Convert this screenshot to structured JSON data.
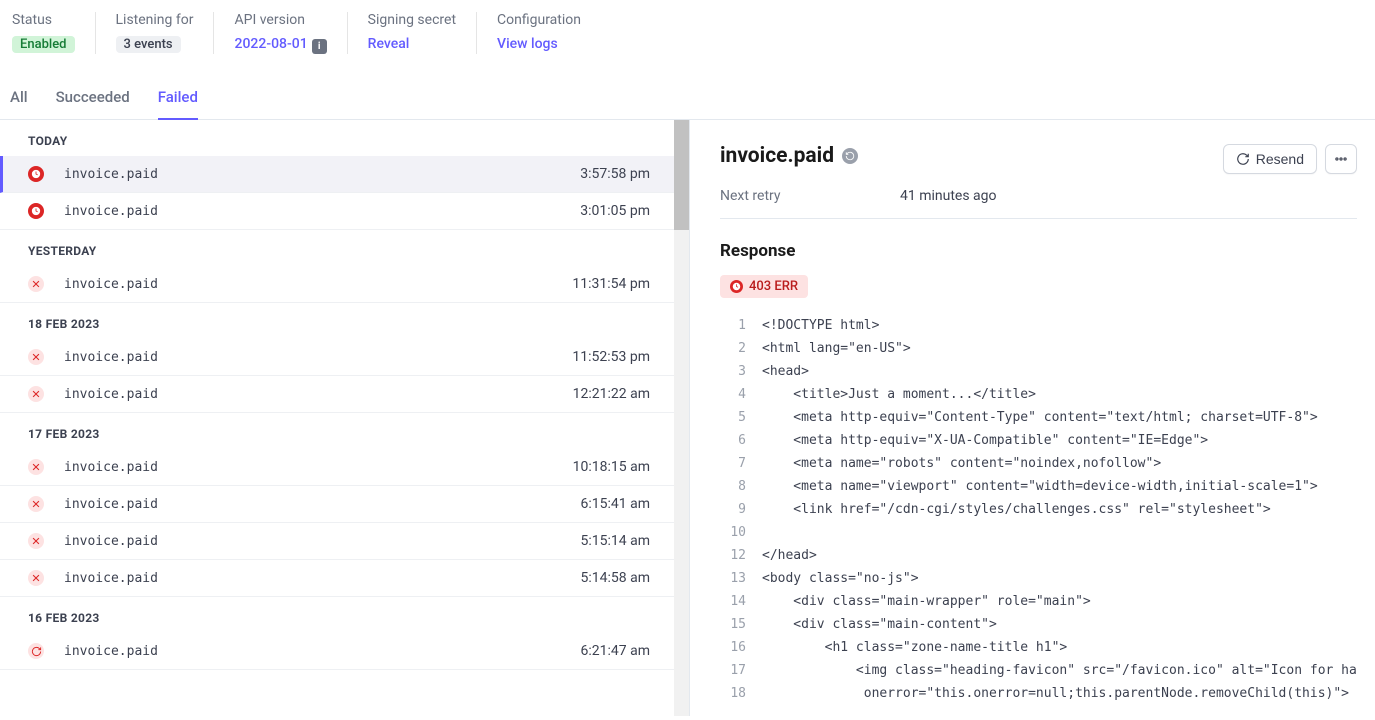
{
  "summary": {
    "status_label": "Status",
    "status_value": "Enabled",
    "listening_label": "Listening for",
    "listening_value": "3 events",
    "api_label": "API version",
    "api_value": "2022-08-01",
    "secret_label": "Signing secret",
    "secret_value": "Reveal",
    "config_label": "Configuration",
    "config_value": "View logs"
  },
  "tabs": {
    "all": "All",
    "succeeded": "Succeeded",
    "failed": "Failed"
  },
  "groups": [
    {
      "label": "TODAY",
      "events": [
        {
          "icon": "clock",
          "name": "invoice.paid",
          "time": "3:57:58 pm",
          "selected": true
        },
        {
          "icon": "clock",
          "name": "invoice.paid",
          "time": "3:01:05 pm"
        }
      ]
    },
    {
      "label": "YESTERDAY",
      "events": [
        {
          "icon": "x",
          "name": "invoice.paid",
          "time": "11:31:54 pm"
        }
      ]
    },
    {
      "label": "18 FEB 2023",
      "events": [
        {
          "icon": "x",
          "name": "invoice.paid",
          "time": "11:52:53 pm"
        },
        {
          "icon": "x",
          "name": "invoice.paid",
          "time": "12:21:22 am"
        }
      ]
    },
    {
      "label": "17 FEB 2023",
      "events": [
        {
          "icon": "x",
          "name": "invoice.paid",
          "time": "10:18:15 am"
        },
        {
          "icon": "x",
          "name": "invoice.paid",
          "time": "6:15:41 am"
        },
        {
          "icon": "x",
          "name": "invoice.paid",
          "time": "5:15:14 am"
        },
        {
          "icon": "x",
          "name": "invoice.paid",
          "time": "5:14:58 am"
        }
      ]
    },
    {
      "label": "16 FEB 2023",
      "events": [
        {
          "icon": "retry",
          "name": "invoice.paid",
          "time": "6:21:47 am"
        }
      ]
    }
  ],
  "detail": {
    "title": "invoice.paid",
    "next_retry_label": "Next retry",
    "next_retry_value": "41 minutes ago",
    "resend": "Resend",
    "response_heading": "Response",
    "status_badge": "403 ERR",
    "code": [
      "<!DOCTYPE html>",
      "<html lang=\"en-US\">",
      "<head>",
      "    <title>Just a moment...</title>",
      "    <meta http-equiv=\"Content-Type\" content=\"text/html; charset=UTF-8\">",
      "    <meta http-equiv=\"X-UA-Compatible\" content=\"IE=Edge\">",
      "    <meta name=\"robots\" content=\"noindex,nofollow\">",
      "    <meta name=\"viewport\" content=\"width=device-width,initial-scale=1\">",
      "    <link href=\"/cdn-cgi/styles/challenges.css\" rel=\"stylesheet\">",
      "    ",
      "",
      "</head>",
      "<body class=\"no-js\">",
      "    <div class=\"main-wrapper\" role=\"main\">",
      "    <div class=\"main-content\">",
      "        <h1 class=\"zone-name-title h1\">",
      "            <img class=\"heading-favicon\" src=\"/favicon.ico\" alt=\"Icon for haveibeenpw",
      "             onerror=\"this.onerror=null;this.parentNode.removeChild(this)\">"
    ]
  }
}
